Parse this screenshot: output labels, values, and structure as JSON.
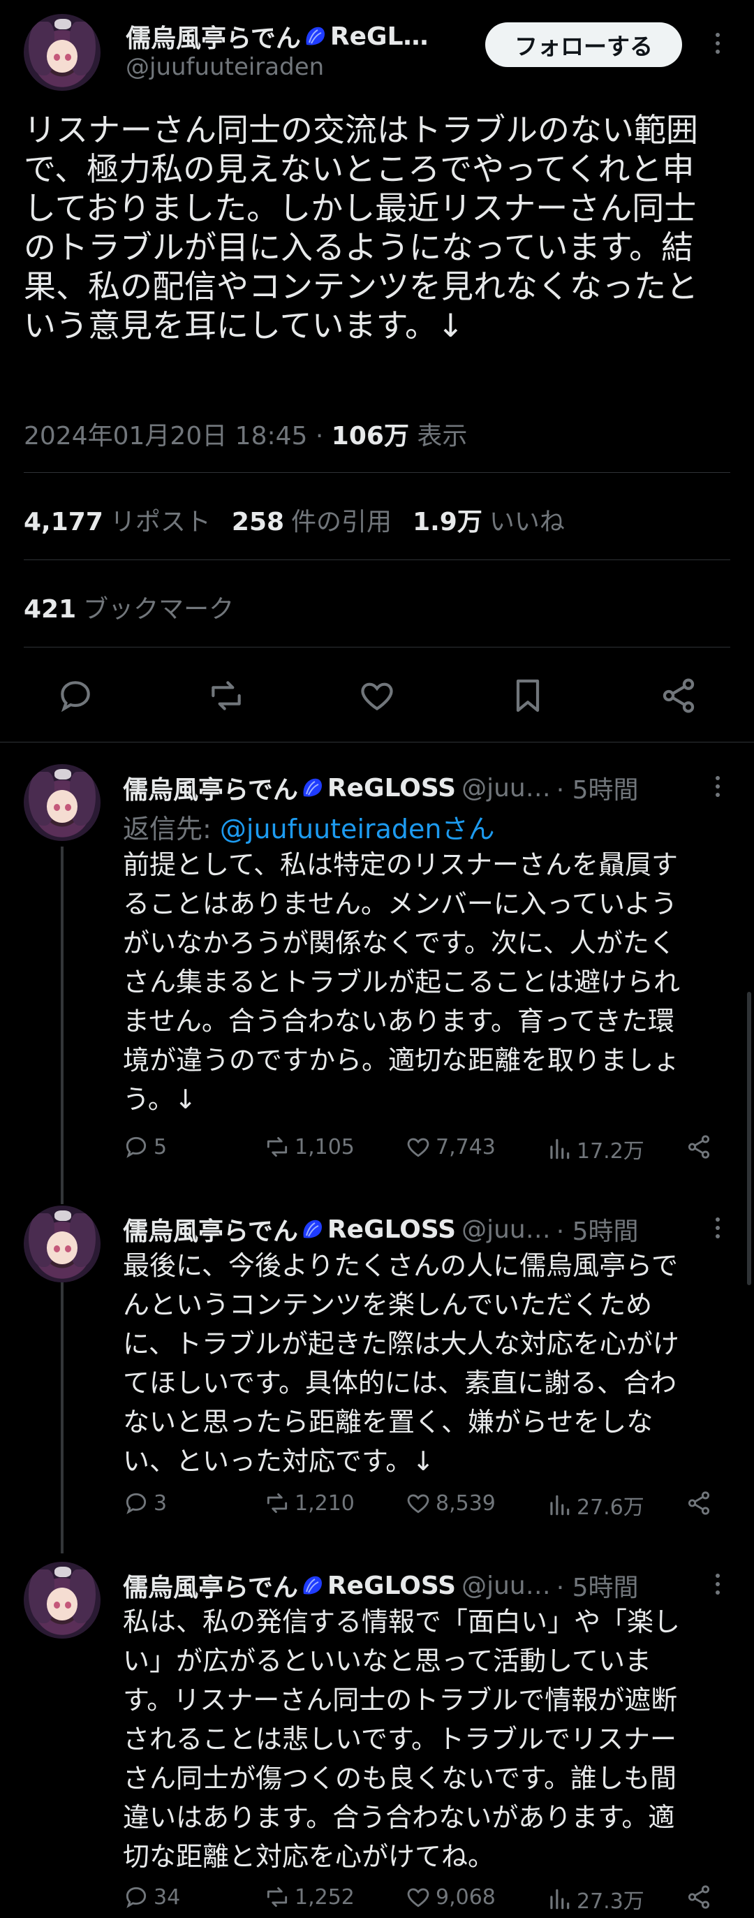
{
  "main_tweet": {
    "author_name": "儒烏風亭らでん",
    "author_group": "ReGL…",
    "handle": "@juufuuteiraden",
    "follow_label": "フォローする",
    "text_lines": [
      "リスナーさん同士の交流はトラブルのない範囲",
      "で、極力私の見えないところでやってくれと申",
      "しておりました。しかし最近リスナーさん同士",
      "のトラブルが目に入るようになっています。結",
      "果、私の配信やコンテンツを見れなくなったと",
      "いう意見を耳にしています。↓"
    ],
    "timestamp": "2024年01月20日 18:45",
    "separator": "·",
    "views_count": "106万",
    "views_label": "表示",
    "reposts_count": "4,177",
    "reposts_label": "リポスト",
    "quotes_count": "258",
    "quotes_label": "件の引用",
    "likes_count": "1.9万",
    "likes_label": "いいね",
    "bookmarks_count": "421",
    "bookmarks_label": "ブックマーク"
  },
  "replies": [
    {
      "author_name": "儒烏風亭らでん",
      "author_group": "ReGLOSS",
      "handle": "@juu…",
      "time": "· 5時間",
      "reply_to_prefix": "返信先: ",
      "reply_to_handle": "@juufuuteiradenさん",
      "text_lines": [
        "前提として、私は特定のリスナーさんを贔屓す",
        "ることはありません。メンバーに入っていよう",
        "がいなかろうが関係なくです。次に、人がたく",
        "さん集まるとトラブルが起こることは避けられ",
        "ません。合う合わないあります。育ってきた環",
        "境が違うのですから。適切な距離を取りましょ",
        "う。↓"
      ],
      "replies": "5",
      "reposts": "1,105",
      "likes": "7,743",
      "views": "17.2万"
    },
    {
      "author_name": "儒烏風亭らでん",
      "author_group": "ReGLOSS",
      "handle": "@juu…",
      "time": "· 5時間",
      "text_lines": [
        "最後に、今後よりたくさんの人に儒烏風亭らで",
        "んというコンテンツを楽しんでいただくため",
        "に、トラブルが起きた際は大人な対応を心がけ",
        "てほしいです。具体的には、素直に謝る、合わ",
        "ないと思ったら距離を置く、嫌がらせをしな",
        "い、といった対応です。↓"
      ],
      "replies": "3",
      "reposts": "1,210",
      "likes": "8,539",
      "views": "27.6万"
    },
    {
      "author_name": "儒烏風亭らでん",
      "author_group": "ReGLOSS",
      "handle": "@juu…",
      "time": "· 5時間",
      "text_lines": [
        "私は、私の発信する情報で「面白い」や「楽し",
        "い」が広がるといいなと思って活動していま",
        "す。リスナーさん同士のトラブルで情報が遮断",
        "されることは悲しいです。トラブルでリスナー",
        "さん同士が傷つくのも良くないです。誰しも間",
        "違いはあります。合う合わないがあります。適",
        "切な距離と対応を心がけてね。"
      ],
      "replies": "34",
      "reposts": "1,252",
      "likes": "9,068",
      "views": "27.3万"
    }
  ],
  "icons": {
    "reply": "reply-icon",
    "repost": "repost-icon",
    "like": "heart-icon",
    "bookmark": "bookmark-icon",
    "share": "share-icon",
    "views": "views-chart-icon",
    "badge": "shell-badge-icon",
    "more": "more-dots-icon"
  },
  "colors": {
    "background": "#000000",
    "text": "#e7e9ea",
    "secondary": "#71767b",
    "link": "#1d9bf0",
    "badge": "#1f3cff",
    "divider": "#2f3336"
  }
}
